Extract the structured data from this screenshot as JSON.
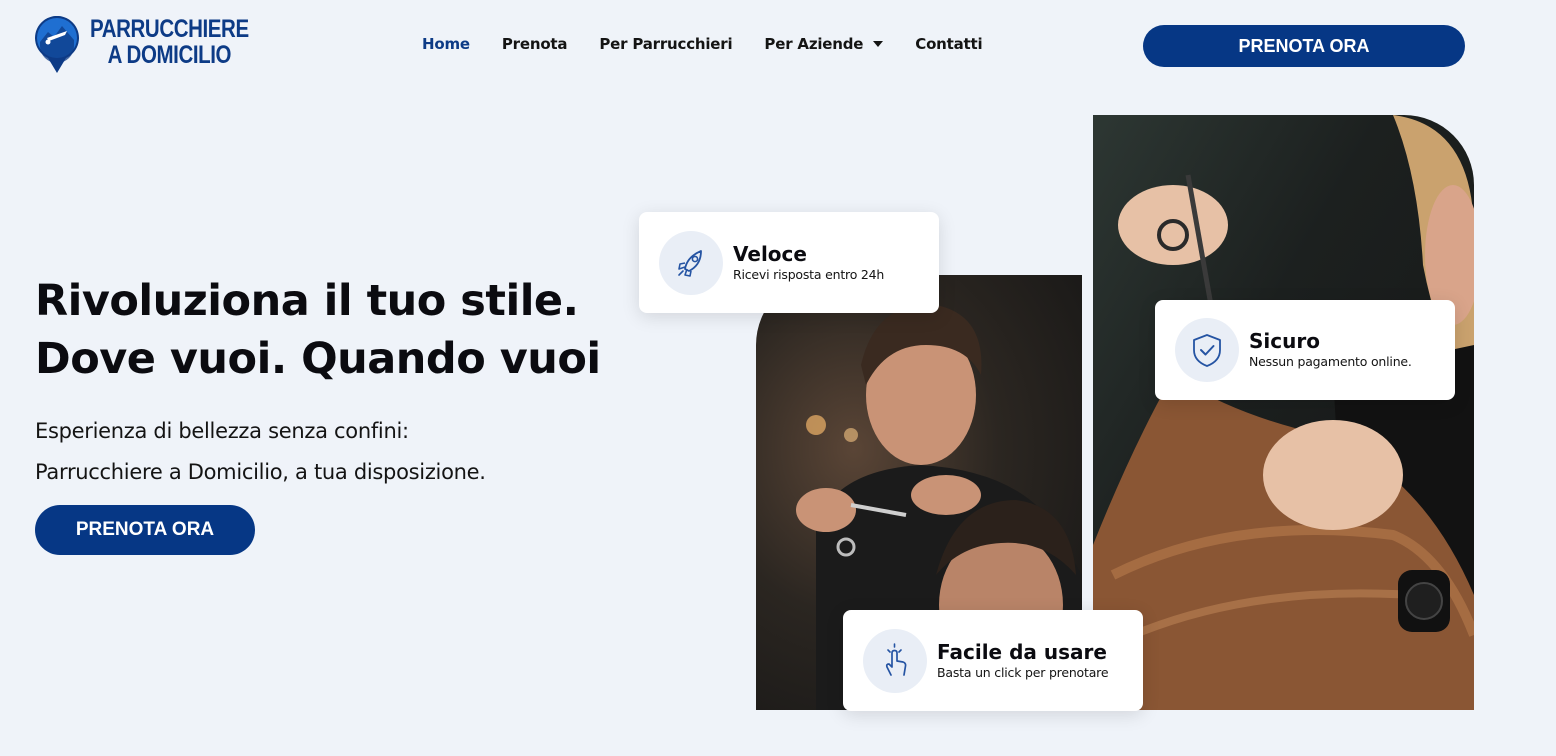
{
  "header": {
    "logo_line1": "PARRUCCHIERE",
    "logo_line2": "A DOMICILIO",
    "nav": [
      {
        "label": "Home",
        "active": true
      },
      {
        "label": "Prenota"
      },
      {
        "label": "Per Parrucchieri"
      },
      {
        "label": "Per Aziende",
        "dropdown": true
      },
      {
        "label": "Contatti"
      }
    ],
    "cta_label": "PRENOTA ORA"
  },
  "hero": {
    "title_line1": "Rivoluziona il tuo stile.",
    "title_line2": "Dove vuoi. Quando vuoi",
    "subtitle_line1": "Esperienza di bellezza senza confini:",
    "subtitle_line2": "Parrucchiere a Domicilio, a tua disposizione.",
    "cta_label": "PRENOTA ORA"
  },
  "features": [
    {
      "title": "Veloce",
      "desc": "Ricevi risposta entro 24h",
      "icon": "rocket-icon"
    },
    {
      "title": "Sicuro",
      "desc": "Nessun pagamento online.",
      "icon": "shield-check-icon"
    },
    {
      "title": "Facile da usare",
      "desc": "Basta un click per prenotare",
      "icon": "hand-click-icon"
    }
  ],
  "colors": {
    "primary": "#063785",
    "background": "#eff3f9",
    "text": "#0b0b10"
  }
}
